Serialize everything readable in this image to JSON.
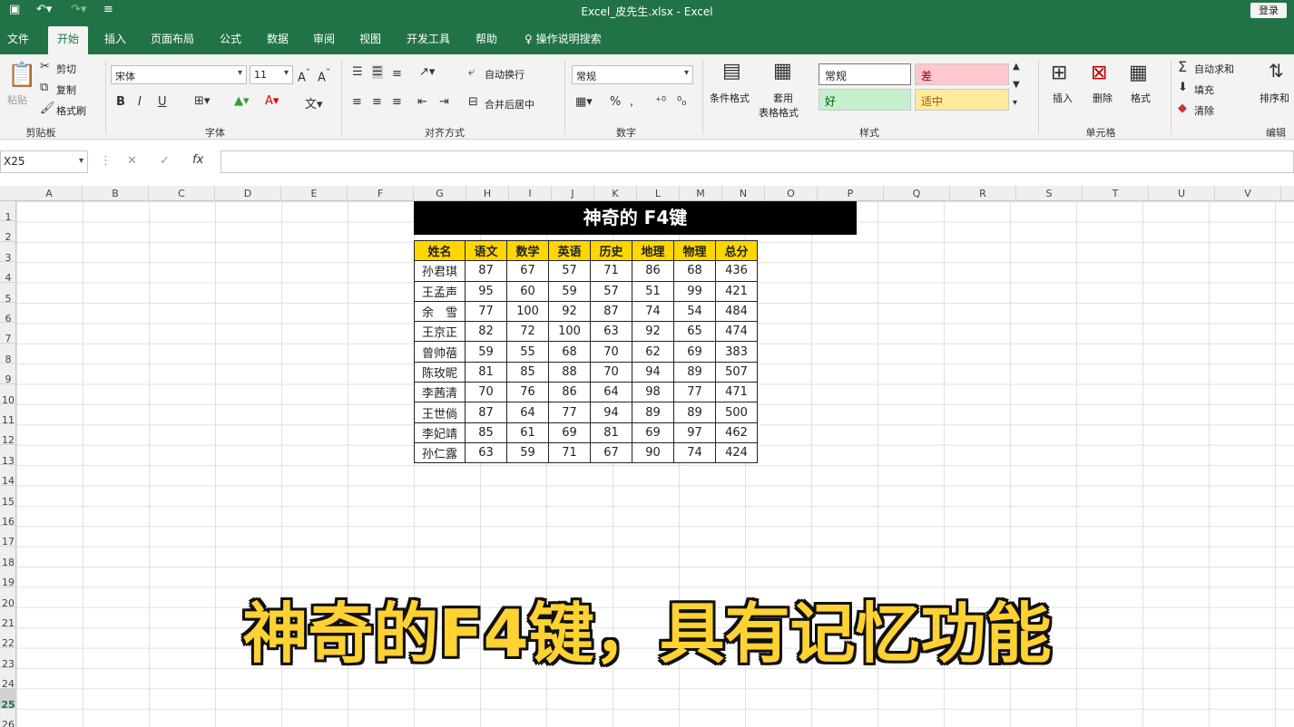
{
  "titlebar": {
    "title": "Excel_皮先生.xlsx  -  Excel",
    "login": "登录"
  },
  "tabs": [
    "文件",
    "开始",
    "插入",
    "页面布局",
    "公式",
    "数据",
    "审阅",
    "视图",
    "开发工具",
    "帮助"
  ],
  "tell_me": "操作说明搜索",
  "ribbon": {
    "clipboard": {
      "paste": "粘贴",
      "cut": "剪切",
      "copy": "复制",
      "format_painter": "格式刷",
      "label": "剪贴板"
    },
    "font": {
      "family": "宋体",
      "size": "11",
      "bold": "B",
      "italic": "I",
      "underline": "U",
      "label": "字体"
    },
    "alignment": {
      "wrap": "自动换行",
      "merge": "合并后居中",
      "label": "对齐方式"
    },
    "number": {
      "format": "常规",
      "percent": "%",
      "label": "数字"
    },
    "styles": {
      "conditional": "条件格式",
      "table_fmt_1": "套用",
      "table_fmt_2": "表格格式",
      "normal": "常规",
      "bad": "差",
      "good": "好",
      "neutral": "适中",
      "label": "样式"
    },
    "cells": {
      "insert": "插入",
      "delete": "删除",
      "format": "格式",
      "label": "单元格"
    },
    "editing": {
      "autosum": "自动求和",
      "fill": "填充",
      "clear": "清除",
      "sort": "排序和",
      "label": "编辑"
    }
  },
  "formula_bar": {
    "name_box": "X25"
  },
  "columns": [
    "A",
    "B",
    "C",
    "D",
    "E",
    "F",
    "G",
    "H",
    "I",
    "J",
    "K",
    "L",
    "M",
    "N",
    "O",
    "P",
    "Q",
    "R",
    "S",
    "T",
    "U",
    "V"
  ],
  "rows": [
    "1",
    "2",
    "3",
    "4",
    "5",
    "6",
    "7",
    "8",
    "9",
    "10",
    "11",
    "12",
    "13",
    "14",
    "15",
    "16",
    "17",
    "18",
    "19",
    "20",
    "21",
    "22",
    "23",
    "24",
    "25",
    "26"
  ],
  "sheet": {
    "title": "神奇的 F4键",
    "headers": [
      "姓名",
      "语文",
      "数学",
      "英语",
      "历史",
      "地理",
      "物理",
      "总分"
    ],
    "rows": [
      [
        "孙君琪",
        "87",
        "67",
        "57",
        "71",
        "86",
        "68",
        "436"
      ],
      [
        "王孟声",
        "95",
        "60",
        "59",
        "57",
        "51",
        "99",
        "421"
      ],
      [
        "余　雪",
        "77",
        "100",
        "92",
        "87",
        "74",
        "54",
        "484"
      ],
      [
        "王京正",
        "82",
        "72",
        "100",
        "63",
        "92",
        "65",
        "474"
      ],
      [
        "曾帅蓓",
        "59",
        "55",
        "68",
        "70",
        "62",
        "69",
        "383"
      ],
      [
        "陈玫昵",
        "81",
        "85",
        "88",
        "70",
        "94",
        "89",
        "507"
      ],
      [
        "李茜清",
        "70",
        "76",
        "86",
        "64",
        "98",
        "77",
        "471"
      ],
      [
        "王世倘",
        "87",
        "64",
        "77",
        "94",
        "89",
        "89",
        "500"
      ],
      [
        "李妃靖",
        "85",
        "61",
        "69",
        "81",
        "69",
        "97",
        "462"
      ],
      [
        "孙仁露",
        "63",
        "59",
        "71",
        "67",
        "90",
        "74",
        "424"
      ]
    ]
  },
  "caption": "神奇的F4键，具有记忆功能"
}
